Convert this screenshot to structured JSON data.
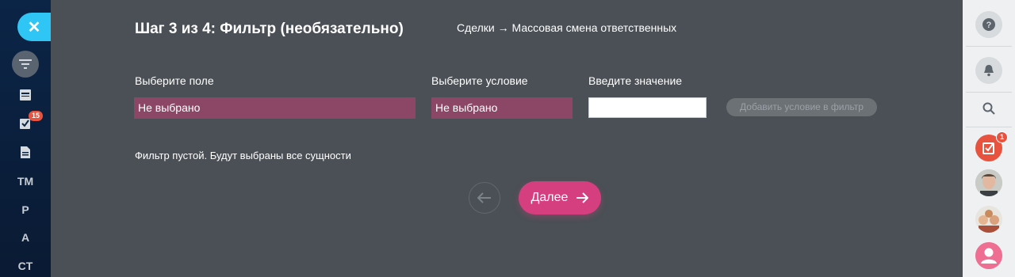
{
  "left_sidebar": {
    "tasks_badge": "15",
    "items": [
      "TM",
      "P",
      "A",
      "CT"
    ]
  },
  "wizard": {
    "step_title": "Шаг 3 из 4: Фильтр (необязательно)",
    "breadcrumb": "Сделки → Массовая смена ответственных",
    "field_label": "Выберите поле",
    "field_value": "Не выбрано",
    "condition_label": "Выберите условие",
    "condition_value": "Не выбрано",
    "value_label": "Введите значение",
    "value_input": "",
    "add_condition_button": "Добавить условие в фильтр",
    "empty_filter_note": "Фильтр пустой. Будут выбраны все сущности",
    "next_button": "Далее"
  },
  "right_sidebar": {
    "tasks_badge": "1"
  },
  "colors": {
    "accent": "#d63f7f",
    "select_bg": "#8c4767",
    "close_tab": "#2fc6f6",
    "overlay_bg": "#4a5055"
  },
  "icons": [
    "close-icon",
    "filter-icon",
    "feed-icon",
    "tasks-icon",
    "document-icon",
    "arrow-left-icon",
    "arrow-right-icon",
    "help-icon",
    "bell-icon",
    "search-icon"
  ]
}
